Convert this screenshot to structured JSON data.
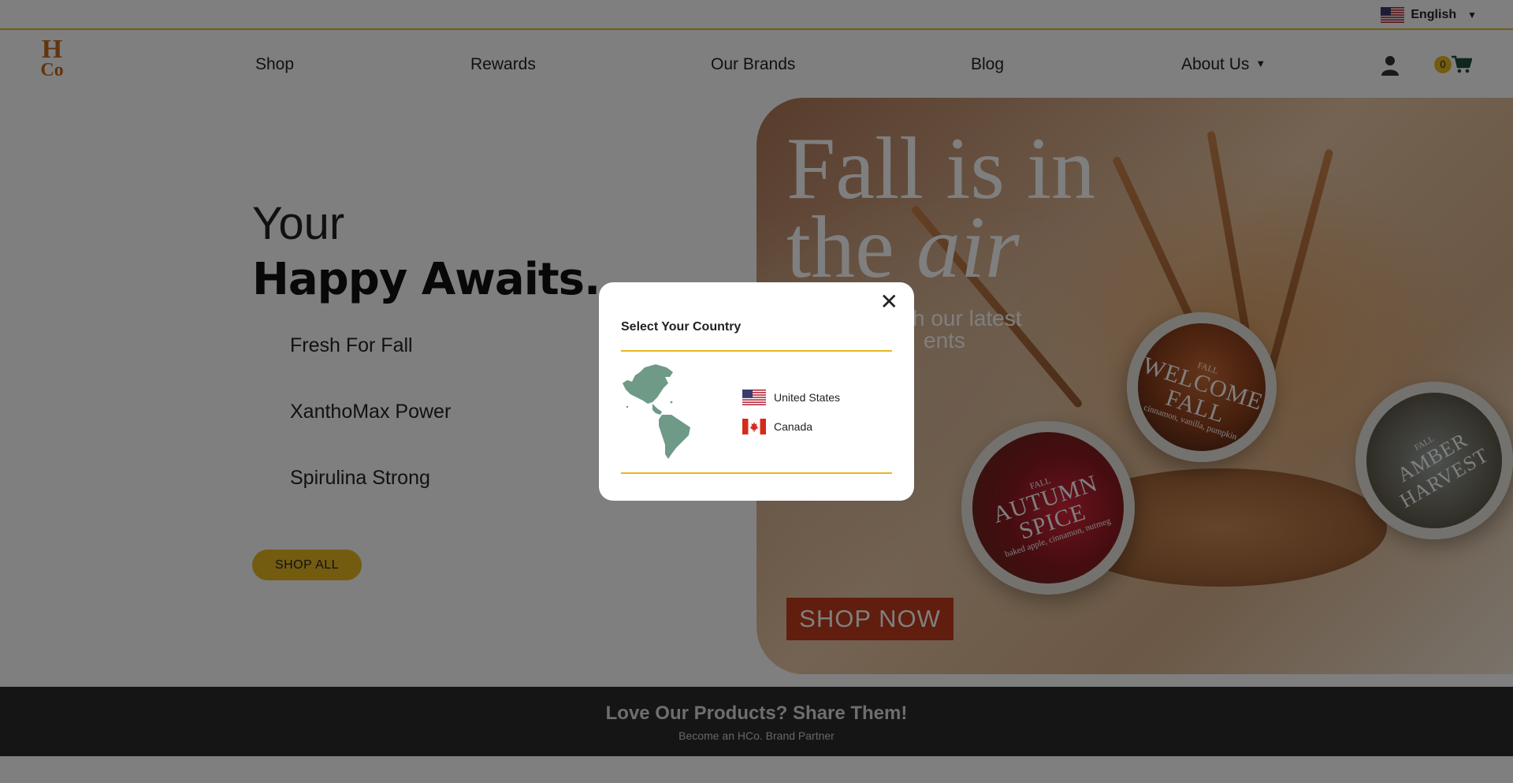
{
  "topbar": {
    "language": "English"
  },
  "nav": {
    "logo_top": "H",
    "logo_bottom": "Co",
    "links": [
      "Shop",
      "Rewards",
      "Our Brands",
      "Blog",
      "About Us"
    ],
    "cart_count": "0"
  },
  "hero": {
    "line1": "Your",
    "line2": "Happy Awaits...",
    "items": [
      "Fresh For Fall",
      "XanthoMax Power",
      "Spirulina Strong"
    ],
    "cta": "SHOP ALL"
  },
  "banner": {
    "title_line1": "Fall is in",
    "title_line2a": "the",
    "title_line2b": "air",
    "subtitle_line1": "h our latest",
    "subtitle_line2": "ents",
    "cta": "SHOP NOW",
    "products": [
      {
        "tag": "FALL",
        "name": "WELCOME FALL",
        "notes": "cinnamon, vanilla, pumpkin"
      },
      {
        "tag": "FALL",
        "name": "AUTUMN SPICE",
        "notes": "baked apple, cinnamon, nutmeg"
      },
      {
        "tag": "FALL",
        "name": "AMBER HARVEST",
        "notes": ""
      }
    ]
  },
  "share": {
    "title": "Love Our Products? Share Them!",
    "subtitle": "Become an HCo. Brand Partner"
  },
  "modal": {
    "close": "✕",
    "title": "Select Your Country",
    "countries": [
      "United States",
      "Canada"
    ]
  },
  "colors": {
    "accent": "#e6b820",
    "brand_orange": "#c56a1e",
    "map_green": "#6e9a87",
    "shop_now_red": "#c23b1c",
    "footer_dark": "#2b2b2b"
  },
  "icons": {
    "language_flag": "us-flag-icon",
    "user": "user-icon",
    "cart": "cart-icon",
    "close": "close-icon",
    "map": "americas-map-icon"
  }
}
